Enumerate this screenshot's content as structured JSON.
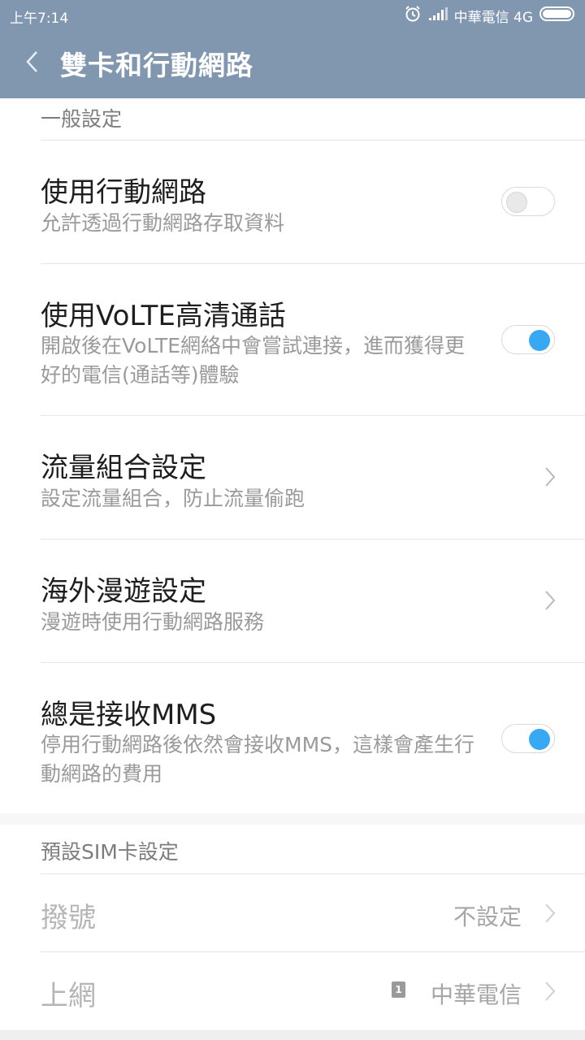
{
  "status_bar": {
    "time": "上午7:14",
    "carrier": "中華電信 4G",
    "icons": [
      "alarm-icon",
      "signal-icon",
      "battery-icon"
    ]
  },
  "app_bar": {
    "title": "雙卡和行動網路",
    "back_icon": "chevron-left-icon"
  },
  "general_section": {
    "header": "一般設定",
    "items": [
      {
        "title": "使用行動網路",
        "subtitle": "允許透過行動網路存取資料",
        "control": "toggle",
        "enabled": false
      },
      {
        "title": "使用VoLTE高清通話",
        "subtitle": "開啟後在VoLTE網絡中會嘗試連接，進而獲得更好的電信(通話等)體驗",
        "control": "toggle",
        "enabled": true
      },
      {
        "title": "流量組合設定",
        "subtitle": "設定流量組合，防止流量偷跑",
        "control": "chevron"
      },
      {
        "title": "海外漫遊設定",
        "subtitle": "漫遊時使用行動網路服務",
        "control": "chevron"
      },
      {
        "title": "總是接收MMS",
        "subtitle": "停用行動網路後依然會接收MMS，這樣會產生行動網路的費用",
        "control": "toggle",
        "enabled": true
      }
    ]
  },
  "sim_section": {
    "header": "預設SIM卡設定",
    "items": [
      {
        "title": "撥號",
        "value": "不設定"
      },
      {
        "title": "上網",
        "value": "中華電信",
        "sim_badge": "1"
      }
    ]
  },
  "colors": {
    "app_bar": "#8197b0",
    "toggle_on": "#37a8f4",
    "background": "#f7f7f7"
  }
}
